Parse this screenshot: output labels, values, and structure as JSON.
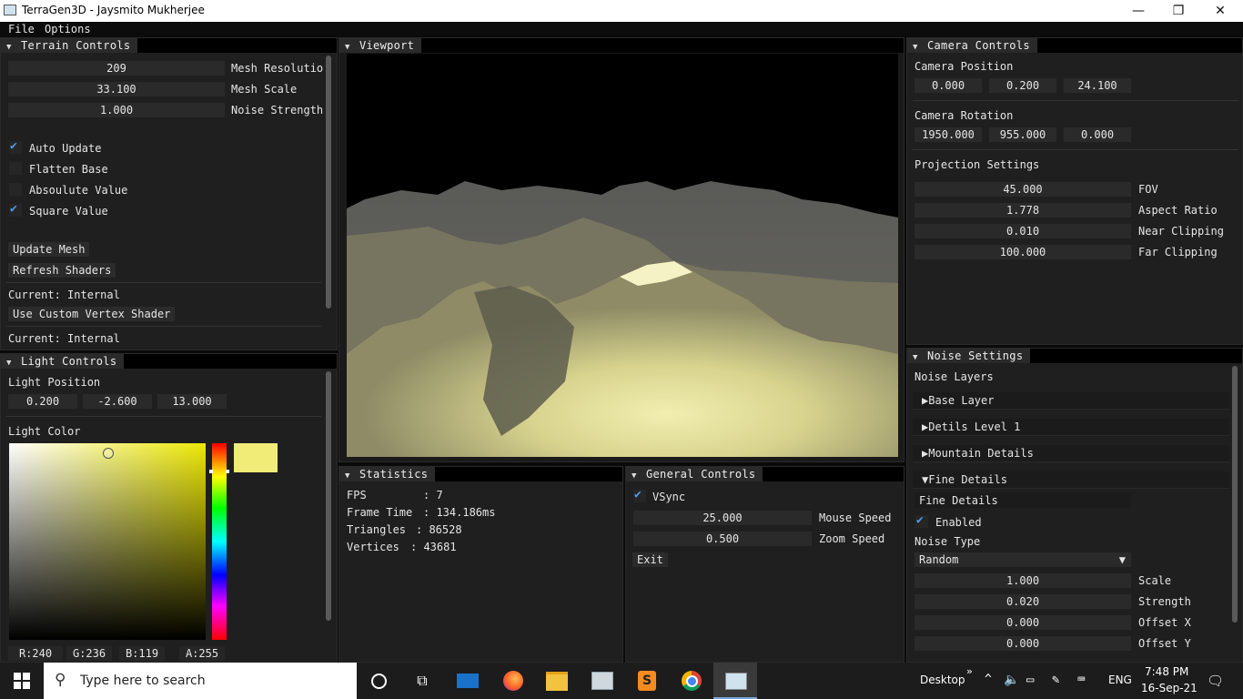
{
  "window": {
    "title": "TerraGen3D - Jaysmito Mukherjee",
    "minimize": "—",
    "restore": "❐",
    "close": "✕"
  },
  "menu": {
    "file": "File",
    "options": "Options"
  },
  "terrain": {
    "title": "Terrain Controls",
    "fields": [
      {
        "value": "209",
        "label": "Mesh Resolutio"
      },
      {
        "value": "33.100",
        "label": "Mesh Scale"
      },
      {
        "value": "1.000",
        "label": "Noise Strength"
      }
    ],
    "checks": [
      {
        "label": "Auto Update",
        "checked": true
      },
      {
        "label": "Flatten Base",
        "checked": false
      },
      {
        "label": "Absoulute Value",
        "checked": false
      },
      {
        "label": "Square Value",
        "checked": true
      }
    ],
    "update_mesh": "Update Mesh",
    "refresh_shaders": "Refresh Shaders",
    "current1": "Current: Internal",
    "custom_vertex": "Use Custom Vertex Shader",
    "current2": "Current: Internal"
  },
  "light": {
    "title": "Light Controls",
    "position_label": "Light Position",
    "position": [
      "0.200",
      "-2.600",
      "13.000"
    ],
    "color_label": "Light Color",
    "swatch_color": "#f0ec77",
    "rgba": [
      "R:240",
      "G:236",
      "B:119",
      "A:255"
    ]
  },
  "viewport": {
    "title": "Viewport"
  },
  "stats": {
    "title": "Statistics",
    "rows": [
      {
        "k": "FPS",
        "v": ": 7"
      },
      {
        "k": "Frame Time",
        "v": ": 134.186ms"
      },
      {
        "k": "Triangles",
        "v": ": 86528"
      },
      {
        "k": "Vertices",
        "v": ": 43681"
      }
    ]
  },
  "general": {
    "title": "General Controls",
    "vsync": "VSync",
    "mouse_speed": {
      "value": "25.000",
      "label": "Mouse Speed"
    },
    "zoom_speed": {
      "value": "0.500",
      "label": "Zoom Speed"
    },
    "exit": "Exit"
  },
  "camera": {
    "title": "Camera Controls",
    "position_label": "Camera Position",
    "position": [
      "0.000",
      "0.200",
      "24.100"
    ],
    "rotation_label": "Camera Rotation",
    "rotation": [
      "1950.000",
      "955.000",
      "0.000"
    ],
    "projection_label": "Projection Settings",
    "projection": [
      {
        "value": "45.000",
        "label": "FOV"
      },
      {
        "value": "1.778",
        "label": "Aspect Ratio"
      },
      {
        "value": "0.010",
        "label": "Near Clipping"
      },
      {
        "value": "100.000",
        "label": "Far Clipping"
      }
    ]
  },
  "noise": {
    "title": "Noise Settings",
    "layers_label": "Noise Layers",
    "layers": [
      "▶Base Layer",
      "▶Detils Level 1",
      "▶Mountain Details",
      "▼Fine Details"
    ],
    "fine_name": "Fine Details",
    "enabled": "Enabled",
    "type_label": "Noise Type",
    "type_value": "Random",
    "params": [
      {
        "value": "1.000",
        "label": "Scale"
      },
      {
        "value": "0.020",
        "label": "Strength"
      },
      {
        "value": "0.000",
        "label": "Offset X"
      },
      {
        "value": "0.000",
        "label": "Offset Y"
      }
    ]
  },
  "taskbar": {
    "search_placeholder": "Type here to search",
    "desktop": "Desktop",
    "lang": "ENG",
    "time": "7:48 PM",
    "date": "16-Sep-21"
  }
}
